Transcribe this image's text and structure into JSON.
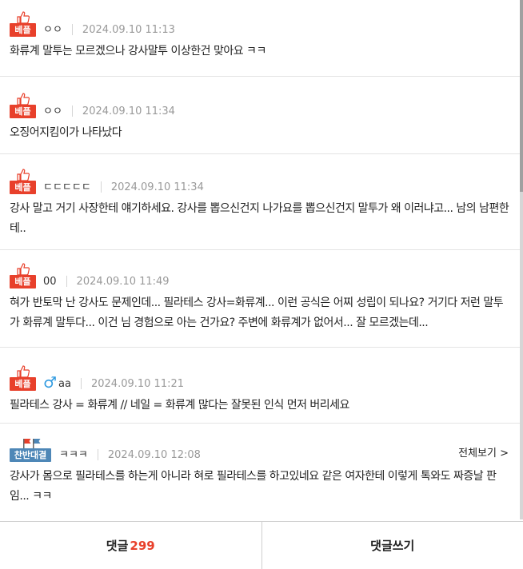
{
  "comments": [
    {
      "badge": "베플",
      "author": "ㅇㅇ",
      "date": "2024.09.10 11:13",
      "text": "화류계 말투는 모르겠으나 강사말투 이상한건 맞아요 ㅋㅋ"
    },
    {
      "badge": "베플",
      "author": "ㅇㅇ",
      "date": "2024.09.10 11:34",
      "text": "오징어지킴이가 나타났다"
    },
    {
      "badge": "베플",
      "author": "ㄷㄷㄷㄷㄷ",
      "date": "2024.09.10 11:34",
      "text": "강사 말고 거기 사장한테 얘기하세요. 강사를 뽑으신건지 나가요를 뽑으신건지 말투가 왜 이러냐고... 남의 남편한테.."
    },
    {
      "badge": "베플",
      "author": "00",
      "date": "2024.09.10 11:49",
      "text": "혀가 반토막 난 강사도 문제인데... 필라테스 강사=화류계... 이런 공식은 어찌 성립이 되나요? 거기다 저런 말투가 화류계 말투다... 이건 님 경험으로 아는 건가요? 주변에 화류계가 없어서... 잘 모르겠는데..."
    },
    {
      "badge": "베플",
      "gender": "♂",
      "author": "aa",
      "date": "2024.09.10 11:21",
      "text": "필라테스 강사 = 화류계 // 네일 = 화류계 많다는 잘못된 인식 먼저 버리세요"
    },
    {
      "badge": "찬반대결",
      "author": "ㅋㅋㅋ",
      "date": "2024.09.10 12:08",
      "view_all": "전체보기 >",
      "text": "강사가 몸으로 필라테스를 하는게 아니라 혀로 필라테스를 하고있네요 같은 여자한테 이렇게 톡와도 짜증날 판임... ㅋㅋ"
    }
  ],
  "bottom_bar": {
    "comments_label": "댓글",
    "comments_count": "299",
    "write_label": "댓글쓰기"
  },
  "colors": {
    "best_badge": "#e8402b",
    "debate_badge": "#4e87b7",
    "count": "#e8402b"
  }
}
